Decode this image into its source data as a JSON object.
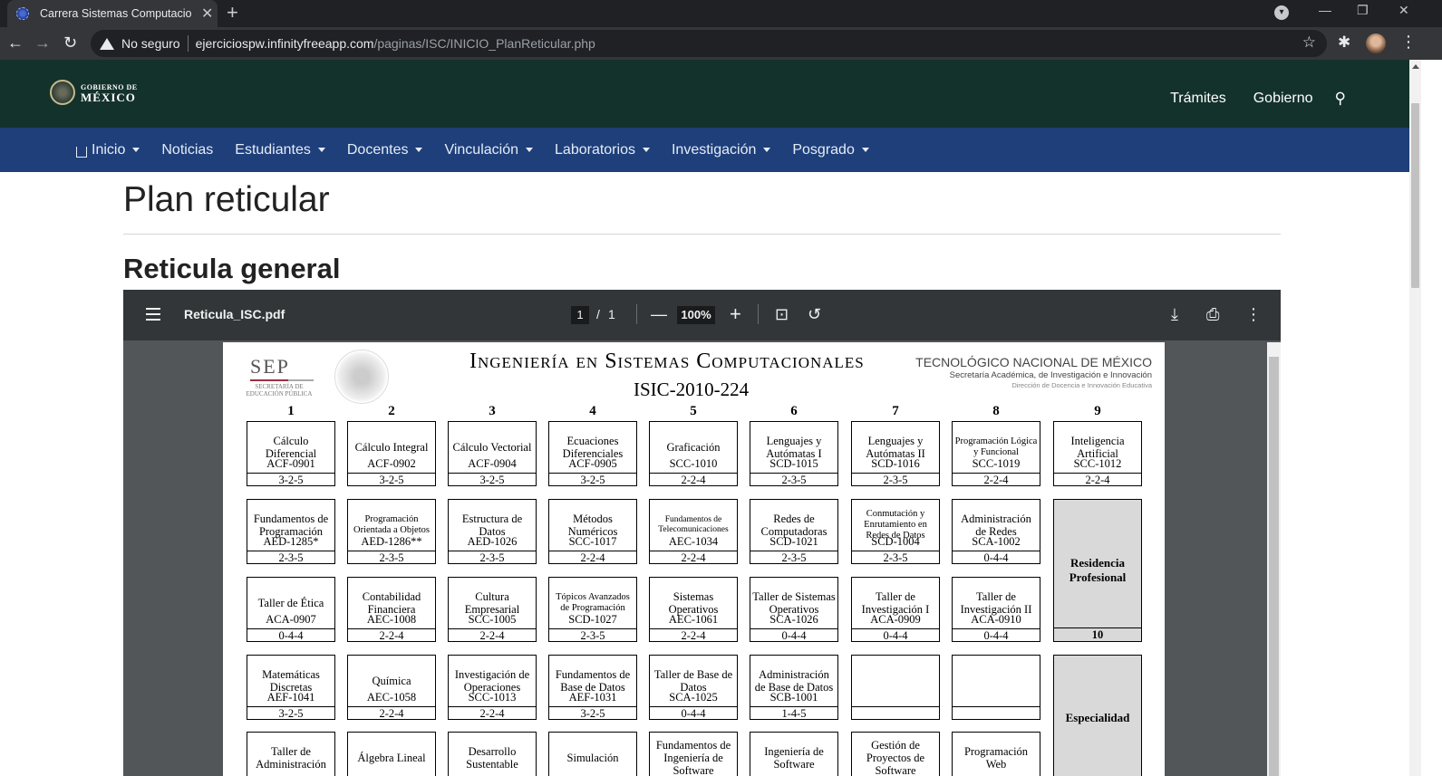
{
  "browser": {
    "tab_title": "Carrera Sistemas Computacionales",
    "address_warning": "No seguro",
    "url_host": "ejerciciospw.infinityfreeapp.com",
    "url_path": "/paginas/ISC/INICIO_PlanReticular.php"
  },
  "gov_header": {
    "logo_line1": "GOBIERNO DE",
    "logo_line2": "MÉXICO",
    "links": [
      "Trámites",
      "Gobierno"
    ]
  },
  "main_nav": {
    "items": [
      {
        "label": "Inicio",
        "has_dropdown": true
      },
      {
        "label": "Noticias",
        "has_dropdown": false
      },
      {
        "label": "Estudiantes",
        "has_dropdown": true
      },
      {
        "label": "Docentes",
        "has_dropdown": true
      },
      {
        "label": "Vinculación",
        "has_dropdown": true
      },
      {
        "label": "Laboratorios",
        "has_dropdown": true
      },
      {
        "label": "Investigación",
        "has_dropdown": true
      },
      {
        "label": "Posgrado",
        "has_dropdown": true
      }
    ]
  },
  "page": {
    "title": "Plan reticular",
    "subtitle": "Reticula general"
  },
  "pdf_viewer": {
    "file_name": "Reticula_ISC.pdf",
    "current_page": "1",
    "page_separator": "/",
    "total_pages": "1",
    "zoom": "100%"
  },
  "document": {
    "sep_big": "SEP",
    "sep_small_1": "SECRETARÍA DE",
    "sep_small_2": "EDUCACIÓN PÚBLICA",
    "title": "Ingeniería en Sistemas Computacionales",
    "code": "ISIC-2010-224",
    "tecnm_1": "TECNOLÓGICO NACIONAL DE MÉXICO",
    "tecnm_2": "Secretaría Académica, de Investigación e Innovación",
    "tecnm_3": "Dirección de Docencia e Innovación Educativa",
    "semesters": [
      "1",
      "2",
      "3",
      "4",
      "5",
      "6",
      "7",
      "8",
      "9"
    ],
    "rows": [
      [
        {
          "name": "Cálculo Diferencial",
          "code": "ACF-0901",
          "credits": "3-2-5"
        },
        {
          "name": "Cálculo Integral",
          "code": "ACF-0902",
          "credits": "3-2-5"
        },
        {
          "name": "Cálculo Vectorial",
          "code": "ACF-0904",
          "credits": "3-2-5"
        },
        {
          "name": "Ecuaciones Diferenciales",
          "code": "ACF-0905",
          "credits": "3-2-5"
        },
        {
          "name": "Graficación",
          "code": "SCC-1010",
          "credits": "2-2-4"
        },
        {
          "name": "Lenguajes y Autómatas I",
          "code": "SCD-1015",
          "credits": "2-3-5"
        },
        {
          "name": "Lenguajes y Autómatas II",
          "code": "SCD-1016",
          "credits": "2-3-5"
        },
        {
          "name": "Programación Lógica y Funcional",
          "code": "SCC-1019",
          "credits": "2-2-4",
          "size": "small"
        },
        {
          "name": "Inteligencia Artificial",
          "code": "SCC-1012",
          "credits": "2-2-4"
        }
      ],
      [
        {
          "name": "Fundamentos de Programación",
          "code": "AED-1285*",
          "credits": "2-3-5"
        },
        {
          "name": "Programación Orientada a Objetos",
          "code": "AED-1286**",
          "credits": "2-3-5",
          "size": "small"
        },
        {
          "name": "Estructura de Datos",
          "code": "AED-1026",
          "credits": "2-3-5"
        },
        {
          "name": "Métodos Numéricos",
          "code": "SCC-1017",
          "credits": "2-2-4"
        },
        {
          "name": "Fundamentos de Telecomunicaciones",
          "code": "AEC-1034",
          "credits": "2-2-4",
          "size": "tiny"
        },
        {
          "name": "Redes de Computadoras",
          "code": "SCD-1021",
          "credits": "2-3-5"
        },
        {
          "name": "Conmutación y Enrutamiento en Redes de Datos",
          "code": "SCD-1004",
          "credits": "2-3-5",
          "size": "small"
        },
        {
          "name": "Administración de Redes",
          "code": "SCA-1002",
          "credits": "0-4-4"
        }
      ],
      [
        {
          "name": "Taller de Ética",
          "code": "ACA-0907",
          "credits": "0-4-4"
        },
        {
          "name": "Contabilidad Financiera",
          "code": "AEC-1008",
          "credits": "2-2-4"
        },
        {
          "name": "Cultura Empresarial",
          "code": "SCC-1005",
          "credits": "2-2-4"
        },
        {
          "name": "Tópicos Avanzados de Programación",
          "code": "SCD-1027",
          "credits": "2-3-5",
          "size": "small"
        },
        {
          "name": "Sistemas Operativos",
          "code": "AEC-1061",
          "credits": "2-2-4"
        },
        {
          "name": "Taller de Sistemas Operativos",
          "code": "SCA-1026",
          "credits": "0-4-4"
        },
        {
          "name": "Taller de Investigación I",
          "code": "ACA-0909",
          "credits": "0-4-4"
        },
        {
          "name": "Taller de Investigación II",
          "code": "ACA-0910",
          "credits": "0-4-4"
        }
      ],
      [
        {
          "name": "Matemáticas Discretas",
          "code": "AEF-1041",
          "credits": "3-2-5"
        },
        {
          "name": "Química",
          "code": "AEC-1058",
          "credits": "2-2-4"
        },
        {
          "name": "Investigación de Operaciones",
          "code": "SCC-1013",
          "credits": "2-2-4"
        },
        {
          "name": "Fundamentos de Base de Datos",
          "code": "AEF-1031",
          "credits": "3-2-5"
        },
        {
          "name": "Taller de Base de Datos",
          "code": "SCA-1025",
          "credits": "0-4-4"
        },
        {
          "name": "Administración de Base de Datos",
          "code": "SCB-1001",
          "credits": "1-4-5"
        },
        {
          "name": "",
          "code": "",
          "credits": ""
        },
        {
          "name": "",
          "code": "",
          "credits": ""
        }
      ],
      [
        {
          "name": "Taller de Administración",
          "code": "",
          "credits": ""
        },
        {
          "name": "Álgebra Lineal",
          "code": "",
          "credits": ""
        },
        {
          "name": "Desarrollo Sustentable",
          "code": "",
          "credits": ""
        },
        {
          "name": "Simulación",
          "code": "",
          "credits": ""
        },
        {
          "name": "Fundamentos de Ingeniería de Software",
          "code": "",
          "credits": ""
        },
        {
          "name": "Ingeniería de Software",
          "code": "",
          "credits": ""
        },
        {
          "name": "Gestión de Proyectos de Software",
          "code": "",
          "credits": ""
        },
        {
          "name": "Programación Web",
          "code": "",
          "credits": ""
        }
      ]
    ],
    "residencia_label": "Residencia Profesional",
    "residencia_credits": "10",
    "especialidad_label": "Especialidad"
  }
}
